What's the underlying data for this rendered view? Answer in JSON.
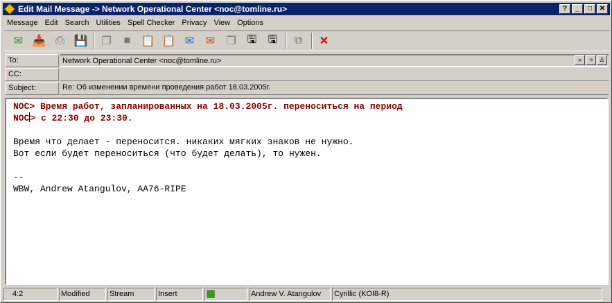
{
  "window": {
    "title": "Edit Mail Message -> Network Operational Center <noc@tomline.ru>",
    "buttons": [
      "help",
      "minimize",
      "maximize",
      "close"
    ]
  },
  "menu": [
    "Message",
    "Edit",
    "Search",
    "Utilities",
    "Spell Checker",
    "Privacy",
    "View",
    "Options"
  ],
  "toolbar": {
    "icons": [
      "send-icon",
      "queue-icon",
      "print-icon",
      "save-icon",
      "copy-icon",
      "cut-icon",
      "paste-icon",
      "paste-quoted-icon",
      "encrypt-icon",
      "sign-icon",
      "insert-file-icon",
      "save-file-icon",
      "save-as-icon",
      "attach-icon",
      "cancel-icon"
    ]
  },
  "headers": {
    "to_label": "To:",
    "to_value": "Network Operational Center <noc@tomline.ru>",
    "cc_label": "CC:",
    "cc_value": "",
    "subject_label": "Subject:",
    "subject_value": "Re: Об изменении времени проведения работ 18.03.2005г."
  },
  "body": {
    "q1": "NOC> Время работ, запланированных на 18.03.2005г. переноситься на период",
    "q2a": "NOC",
    "q2b": "> с 22:30 до 23:30.",
    "l1": "Время что делает - переносится. никаких мягких знаков не нужно.",
    "l2": "Вот если будет переноситься (что будет делать), то нужен.",
    "sigsep": "--",
    "sig": "WBW, Andrew Atangulov, AA76-RIPE"
  },
  "status": {
    "position": "4:2",
    "modified": "Modified",
    "mode": "Stream",
    "insert": "Insert",
    "user": "Andrew V. Atangulov",
    "encoding": "Cyrillic (KOI8-R)"
  }
}
